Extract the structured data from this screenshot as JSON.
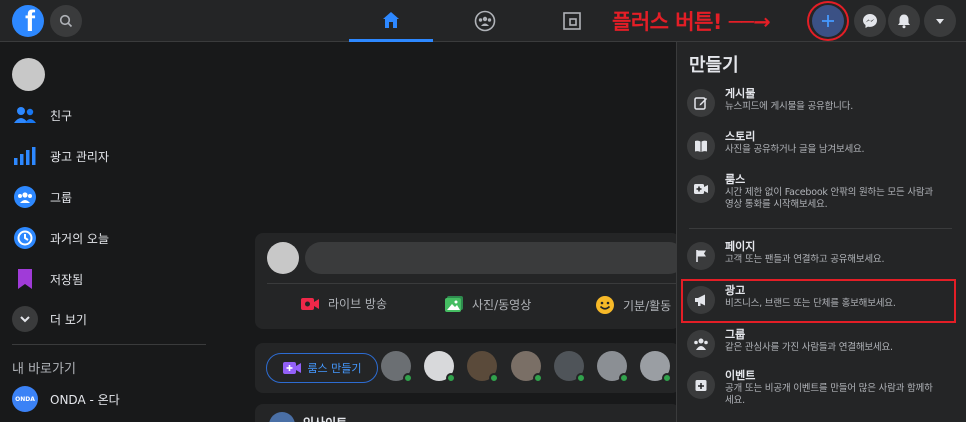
{
  "topbar": {
    "logo": "f",
    "annotation": "플러스 버튼! ──→"
  },
  "sidebar": {
    "items": [
      {
        "label": "친구",
        "icon": "friends-icon"
      },
      {
        "label": "광고 관리자",
        "icon": "ads-manager-icon"
      },
      {
        "label": "그룹",
        "icon": "groups-icon"
      },
      {
        "label": "과거의 오늘",
        "icon": "memories-icon"
      },
      {
        "label": "저장됨",
        "icon": "saved-icon"
      },
      {
        "label": "더 보기",
        "icon": "chevron-down-icon"
      }
    ],
    "shortcuts_heading": "내 바로가기",
    "shortcut": {
      "label": "ONDA - 온다",
      "badge": "ONDA"
    }
  },
  "composer": {
    "actions": [
      {
        "label": "라이브 방송",
        "icon": "live-video-icon",
        "color": "#f02849"
      },
      {
        "label": "사진/동영상",
        "icon": "photo-icon",
        "color": "#45bd62"
      },
      {
        "label": "기분/활동",
        "icon": "feeling-icon",
        "color": "#f7b928"
      }
    ]
  },
  "rooms": {
    "button_label": "룸스 만들기"
  },
  "post_peek": {
    "name": "인사이트"
  },
  "dropdown": {
    "title": "만들기",
    "items": [
      {
        "title": "게시물",
        "desc": [
          "뉴스피드에 게시물을 공유합니다."
        ],
        "icon": "edit-icon"
      },
      {
        "title": "스토리",
        "desc": [
          "사진을 공유하거나 글을 남겨보세요."
        ],
        "icon": "book-icon"
      },
      {
        "title": "룸스",
        "desc": [
          "시간 제한 없이 Facebook 안팎의 원하는 모든 사람과",
          "영상 통화를 시작해보세요."
        ],
        "icon": "video-plus-icon"
      },
      {
        "title": "페이지",
        "desc": [
          "고객 또는 팬들과 연결하고 공유해보세요."
        ],
        "icon": "flag-icon"
      },
      {
        "title": "광고",
        "desc": [
          "비즈니스, 브랜드 또는 단체를 홍보해보세요."
        ],
        "icon": "megaphone-icon"
      },
      {
        "title": "그룹",
        "desc": [
          "같은 관심사를 가진 사람들과 연결해보세요."
        ],
        "icon": "groups-icon"
      },
      {
        "title": "이벤트",
        "desc": [
          "공개 또는 비공개 이벤트를 만들어 많은 사람과 함께하",
          "세요."
        ],
        "icon": "calendar-plus-icon"
      }
    ]
  },
  "colors": {
    "accent": "#2d88ff",
    "annotation_red": "#e41e26",
    "background": "#18191a",
    "surface": "#242526"
  }
}
